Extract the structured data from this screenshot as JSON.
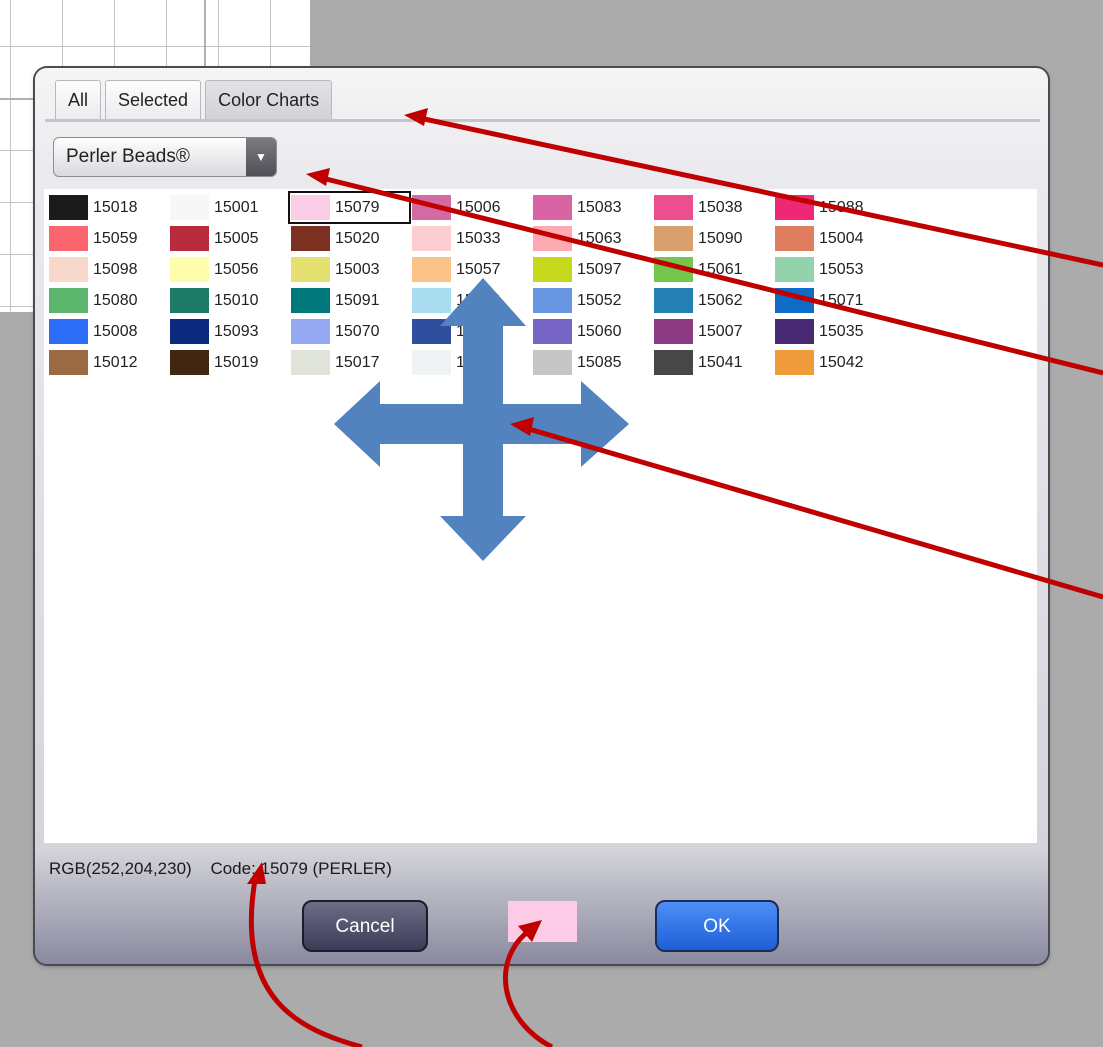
{
  "tabs": [
    {
      "label": "All",
      "active": false
    },
    {
      "label": "Selected",
      "active": false
    },
    {
      "label": "Color Charts",
      "active": true
    }
  ],
  "dropdown": {
    "selected": "Perler Beads®"
  },
  "selected_code": "15079",
  "swatches": [
    {
      "code": "15018",
      "color": "#1b1b1b"
    },
    {
      "code": "15001",
      "color": "#f7f7f7"
    },
    {
      "code": "15079",
      "color": "#fccce6"
    },
    {
      "code": "15006",
      "color": "#d46aa2"
    },
    {
      "code": "15083",
      "color": "#d963a3"
    },
    {
      "code": "15038",
      "color": "#ec4f8c"
    },
    {
      "code": "15088",
      "color": "#ee2875"
    },
    {
      "code": "15059",
      "color": "#fb6570"
    },
    {
      "code": "15005",
      "color": "#b62c3d"
    },
    {
      "code": "15020",
      "color": "#7b3022"
    },
    {
      "code": "15033",
      "color": "#fccdd1"
    },
    {
      "code": "15063",
      "color": "#fca9b1"
    },
    {
      "code": "15090",
      "color": "#d7a06c"
    },
    {
      "code": "15004",
      "color": "#df7e5e"
    },
    {
      "code": "15098",
      "color": "#f8d8cb"
    },
    {
      "code": "15056",
      "color": "#fdfdab"
    },
    {
      "code": "15003",
      "color": "#e4e170"
    },
    {
      "code": "15057",
      "color": "#fbc387"
    },
    {
      "code": "15097",
      "color": "#c7d91d"
    },
    {
      "code": "15061",
      "color": "#75c64d"
    },
    {
      "code": "15053",
      "color": "#93d3ab"
    },
    {
      "code": "15080",
      "color": "#5bb56d"
    },
    {
      "code": "15010",
      "color": "#1e7b66"
    },
    {
      "code": "15091",
      "color": "#01787a"
    },
    {
      "code": "15049",
      "color": "#a9dcef"
    },
    {
      "code": "15052",
      "color": "#6896e0"
    },
    {
      "code": "15062",
      "color": "#2580b4"
    },
    {
      "code": "15071",
      "color": "#0e6bc7"
    },
    {
      "code": "15008",
      "color": "#2c6ef7"
    },
    {
      "code": "15093",
      "color": "#0b2a7d"
    },
    {
      "code": "15070",
      "color": "#95a8f2"
    },
    {
      "code": "15054",
      "color": "#2f4e9e"
    },
    {
      "code": "15060",
      "color": "#7665c5"
    },
    {
      "code": "15007",
      "color": "#8b3a82"
    },
    {
      "code": "15035",
      "color": "#482a72"
    },
    {
      "code": "15012",
      "color": "#9b6a42"
    },
    {
      "code": "15019",
      "color": "#412710"
    },
    {
      "code": "15017",
      "color": "#dfe3d9"
    },
    {
      "code": "15002",
      "color": "#eff3f3"
    },
    {
      "code": "15085",
      "color": "#c6c6c6"
    },
    {
      "code": "15041",
      "color": "#474747"
    },
    {
      "code": "15042",
      "color": "#ef9b3b"
    }
  ],
  "status": {
    "rgb": "RGB(252,204,230)",
    "code": "Code: 15079 (PERLER)"
  },
  "buttons": {
    "cancel": "Cancel",
    "ok": "OK"
  },
  "preview_color": "#fccce6",
  "annotation_colors": {
    "arrow": "#c00000",
    "move": "#5283be"
  }
}
